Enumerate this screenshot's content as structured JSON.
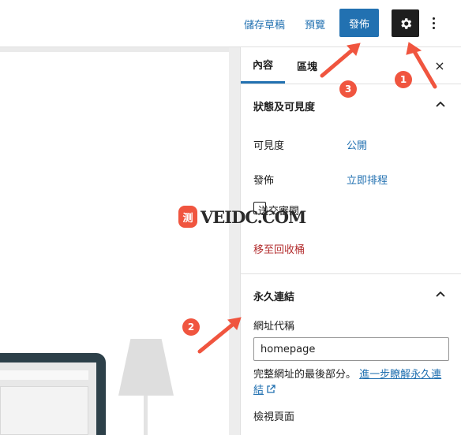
{
  "topbar": {
    "save_draft": "儲存草稿",
    "preview": "預覽",
    "publish": "發佈",
    "settings_icon": "gear-icon",
    "options_icon": "kebab-icon"
  },
  "sidebar": {
    "tabs": [
      "內容",
      "區塊"
    ],
    "close": "×",
    "status_panel": {
      "title": "狀態及可見度",
      "visibility_label": "可見度",
      "visibility_value": "公開",
      "publish_label": "發佈",
      "publish_value": "立即排程",
      "pending_review": "送交審閱",
      "trash": "移至回收桶"
    },
    "permalink_panel": {
      "title": "永久連結",
      "slug_label": "網址代稱",
      "slug_value": "homepage",
      "help_text": "完整網址的最後部分。",
      "learn_more": "進一步瞭解永久連結",
      "view_page": "檢視頁面"
    }
  },
  "annotations": {
    "badges": [
      "1",
      "2",
      "3"
    ],
    "color": "#f0553f"
  },
  "watermark": {
    "logo": "测",
    "text": "VEIDC.COM"
  },
  "colors": {
    "accent": "#2271b1",
    "danger": "#b32d2e",
    "dark": "#1e1e1e"
  }
}
